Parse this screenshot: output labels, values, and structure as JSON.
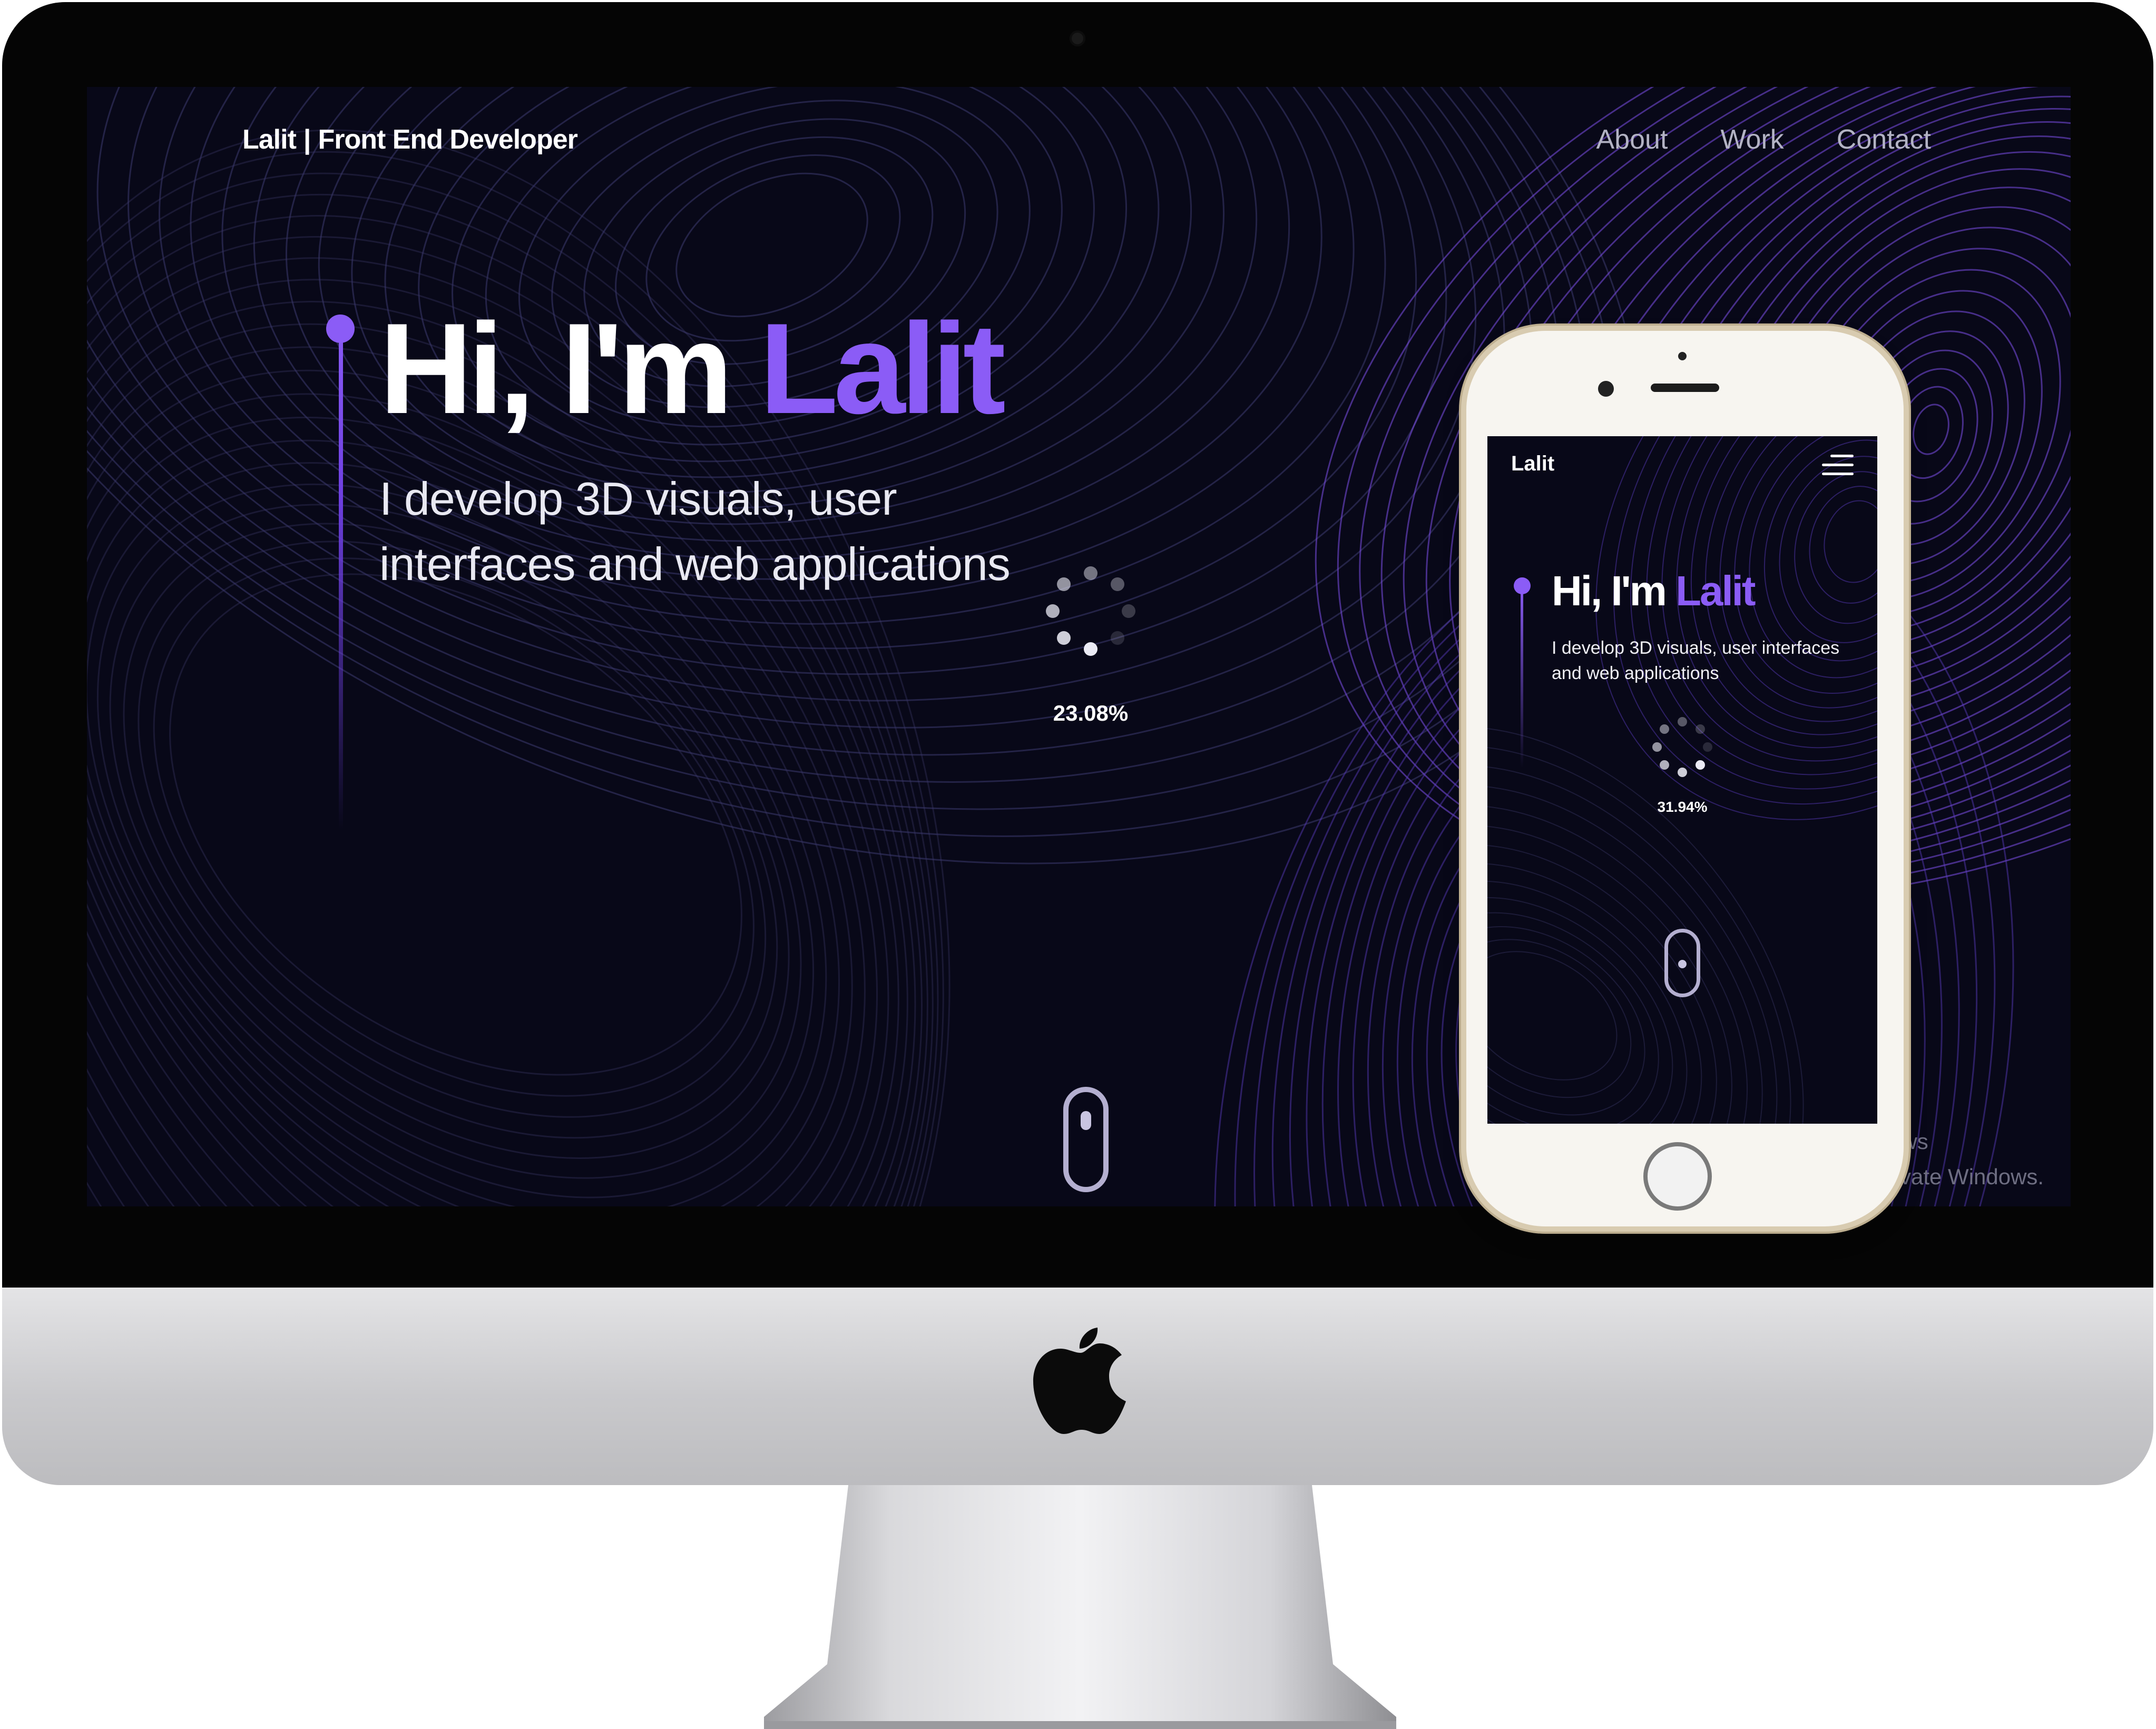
{
  "desktop": {
    "nav": {
      "brand_name": "Lalit",
      "brand_separator": "|",
      "brand_role": "Front End Developer",
      "links": [
        "About",
        "Work",
        "Contact"
      ]
    },
    "hero": {
      "greeting": "Hi, I'm",
      "name": "Lalit",
      "subtitle_line1": "I develop 3D visuals, user",
      "subtitle_line2": "interfaces and web applications"
    },
    "loader": {
      "percent_text": "23.08%"
    },
    "watermark": {
      "line1": "ows",
      "line2": "tivate Windows."
    }
  },
  "mobile": {
    "brand": "Lalit",
    "hero": {
      "greeting": "Hi, I'm",
      "name": "Lalit",
      "subtitle_line1": "I develop 3D visuals, user interfaces",
      "subtitle_line2": "and web applications"
    },
    "loader": {
      "percent_text": "31.94%"
    }
  },
  "colors": {
    "accent": "#8b5cf6",
    "background": "#080818",
    "text": "#ffffff",
    "nav_link": "#b3b3c4"
  },
  "icons": [
    "apple-logo-icon",
    "scroll-mouse-icon",
    "hamburger-menu-icon",
    "loading-spinner-icon"
  ]
}
